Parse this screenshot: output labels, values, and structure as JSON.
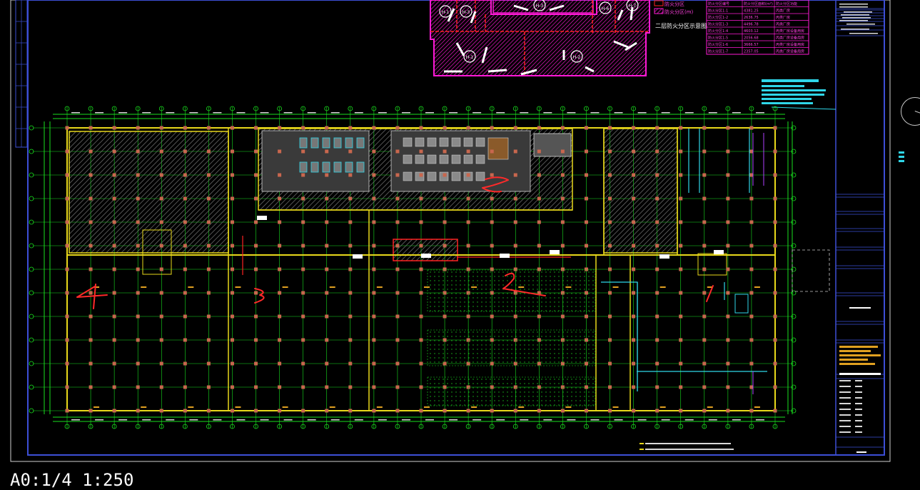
{
  "viewport": {
    "scale_label": "A0:1/4 1:250"
  },
  "colors": {
    "background": "#000000",
    "frame": "#3d4fd6",
    "grid_axis": "#19e01e",
    "walls": "#e8d81a",
    "columns": "#c8674e",
    "hatch": "#5a5a5a",
    "zone_magenta": "#ff1ad6",
    "fire_red": "#ff2222",
    "cyan": "#2fd6e8",
    "markup_red": "#ff2a2a"
  },
  "key_plan": {
    "zone_labels": [
      "H-1",
      "H-3",
      "H-3",
      "H-6",
      "H-7",
      "H-1",
      "H-2"
    ],
    "legend_lines": [
      "防火分区",
      "防火分区(m)",
      "二层防火分区示意图"
    ]
  },
  "area_table": {
    "headers": [
      "防火分区编号",
      "防火分区面积(m²)",
      "防火分区功能"
    ],
    "rows": [
      [
        "防火分区1-1",
        "4381.25",
        "丙类厂房"
      ],
      [
        "防火分区1-2",
        "2636.75",
        "丙类厂房"
      ],
      [
        "防火分区1-3",
        "4496.78",
        "丙类厂房"
      ],
      [
        "防火分区1-4",
        "4603.12",
        "丙类厂房设备用房"
      ],
      [
        "防火分区1-5",
        "2056.68",
        "丙类厂房设备用房"
      ],
      [
        "防火分区1-6",
        "3666.57",
        "丙类厂房设备用房"
      ],
      [
        "防火分区1-7",
        "2357.05",
        "丙类厂房设备用房"
      ]
    ]
  },
  "markups": [
    "4",
    "3",
    "2",
    "1"
  ],
  "icons": {
    "nav_wheel": "navigation-wheel-icon",
    "view_tools": "view-cube-tools-icon"
  }
}
